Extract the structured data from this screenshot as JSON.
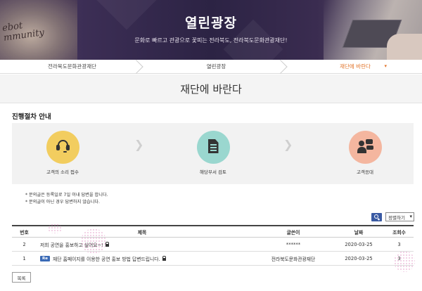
{
  "hero": {
    "title": "열린광장",
    "subtitle": "문화로 빠르고 관광으로 꽃피는 전라북도, 전라북도문화관광재단!",
    "script_text_1": "ebot",
    "script_text_2": "mmunity"
  },
  "breadcrumb": [
    {
      "label": "전라북도문화관광재단"
    },
    {
      "label": "열린광장"
    },
    {
      "label": "재단에 바란다",
      "dropdown": "▾"
    }
  ],
  "page_title": "재단에 바란다",
  "process": {
    "heading": "진행절차 안내",
    "steps": [
      {
        "label": "고객의 소리 접수",
        "icon": "headset-icon",
        "color": "#f2cd5f"
      },
      {
        "label": "해당부서 검토",
        "icon": "document-icon",
        "color": "#9ad7cf"
      },
      {
        "label": "고객응대",
        "icon": "customer-service-icon",
        "color": "#f4b69f"
      }
    ]
  },
  "notes": [
    "* 문의글은 등록일로 7일 이내 답변을 합니다.",
    "* 문의글이 아닌 경우 답변하지 않습니다."
  ],
  "controls": {
    "sort_value": "정렬하기"
  },
  "table": {
    "headers": {
      "no": "번호",
      "title": "제목",
      "writer": "글쓴이",
      "date": "날짜",
      "views": "조회수"
    },
    "rows": [
      {
        "no": "2",
        "title": "저희 공연을 홍보하고 싶어요~!",
        "reply": false,
        "writer": "******",
        "date": "2020-03-25",
        "views": "3"
      },
      {
        "no": "1",
        "badge": "Re",
        "title": "재단 홈페이지를 이용한 공연 홍보 방법 답변드립니다.",
        "reply": true,
        "writer": "전라북도문화관광재단",
        "date": "2020-03-25",
        "views": "3"
      }
    ]
  },
  "list_button": "목록",
  "colors": {
    "accent": "#e2742a",
    "primary_blue": "#3a5aa3"
  }
}
